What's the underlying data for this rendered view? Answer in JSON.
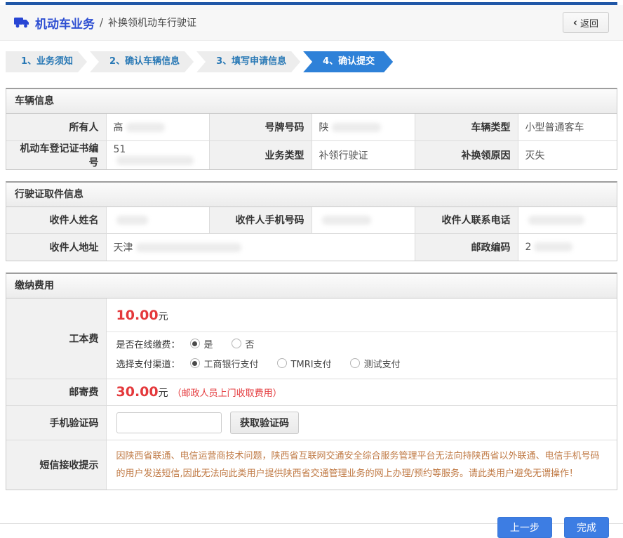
{
  "header": {
    "title": "机动车业务",
    "separator": "/",
    "subtitle": "补换领机动车行驶证",
    "back_icon": "‹",
    "back_label": "返回"
  },
  "steps": {
    "step1": "1、业务须知",
    "step2": "2、确认车辆信息",
    "step3": "3、填写申请信息",
    "step4": "4、确认提交"
  },
  "vehicle": {
    "title": "车辆信息",
    "owner_label": "所有人",
    "owner_value": "高",
    "plate_label": "号牌号码",
    "plate_value": "陕",
    "type_label": "车辆类型",
    "type_value": "小型普通客车",
    "cert_label": "机动车登记证书编号",
    "cert_value": "51",
    "biz_label": "业务类型",
    "biz_value": "补领行驶证",
    "reason_label": "补换领原因",
    "reason_value": "灭失"
  },
  "delivery": {
    "title": "行驶证取件信息",
    "name_label": "收件人姓名",
    "mobile_label": "收件人手机号码",
    "phone_label": "收件人联系电话",
    "address_label": "收件人地址",
    "address_value": "天津",
    "zip_label": "邮政编码",
    "zip_value": "2"
  },
  "payment": {
    "title": "缴纳费用",
    "cost_label": "工本费",
    "cost_amount": "10.00",
    "cost_unit": "元",
    "online_question": "是否在线缴费：",
    "online_yes": "是",
    "online_no": "否",
    "channel_question": "选择支付渠道：",
    "channel_icbc": "工商银行支付",
    "channel_tmri": "TMRI支付",
    "channel_test": "测试支付",
    "post_label": "邮寄费",
    "post_amount": "30.00",
    "post_unit": "元",
    "post_note": "（邮政人员上门收取费用）",
    "captcha_label": "手机验证码",
    "captcha_button": "获取验证码",
    "sms_label": "短信接收提示",
    "sms_notice": "因陕西省联通、电信运营商技术问题，陕西省互联网交通安全综合服务管理平台无法向持陕西省以外联通、电信手机号码的用户发送短信,因此无法向此类用户提供陕西省交通管理业务的网上办理/预约等服务。请此类用户避免无谓操作！"
  },
  "footer": {
    "prev_button": "上一步",
    "finish_button": "完成"
  },
  "colors": {
    "accent_blue": "#2e81d8",
    "title_blue": "#2e4fd2",
    "top_bar_blue": "#2057a7",
    "button_blue": "#3d7de3",
    "price_red": "#e4393c",
    "notice_orange": "#c07a45",
    "step_text_blue": "#2878b5"
  }
}
